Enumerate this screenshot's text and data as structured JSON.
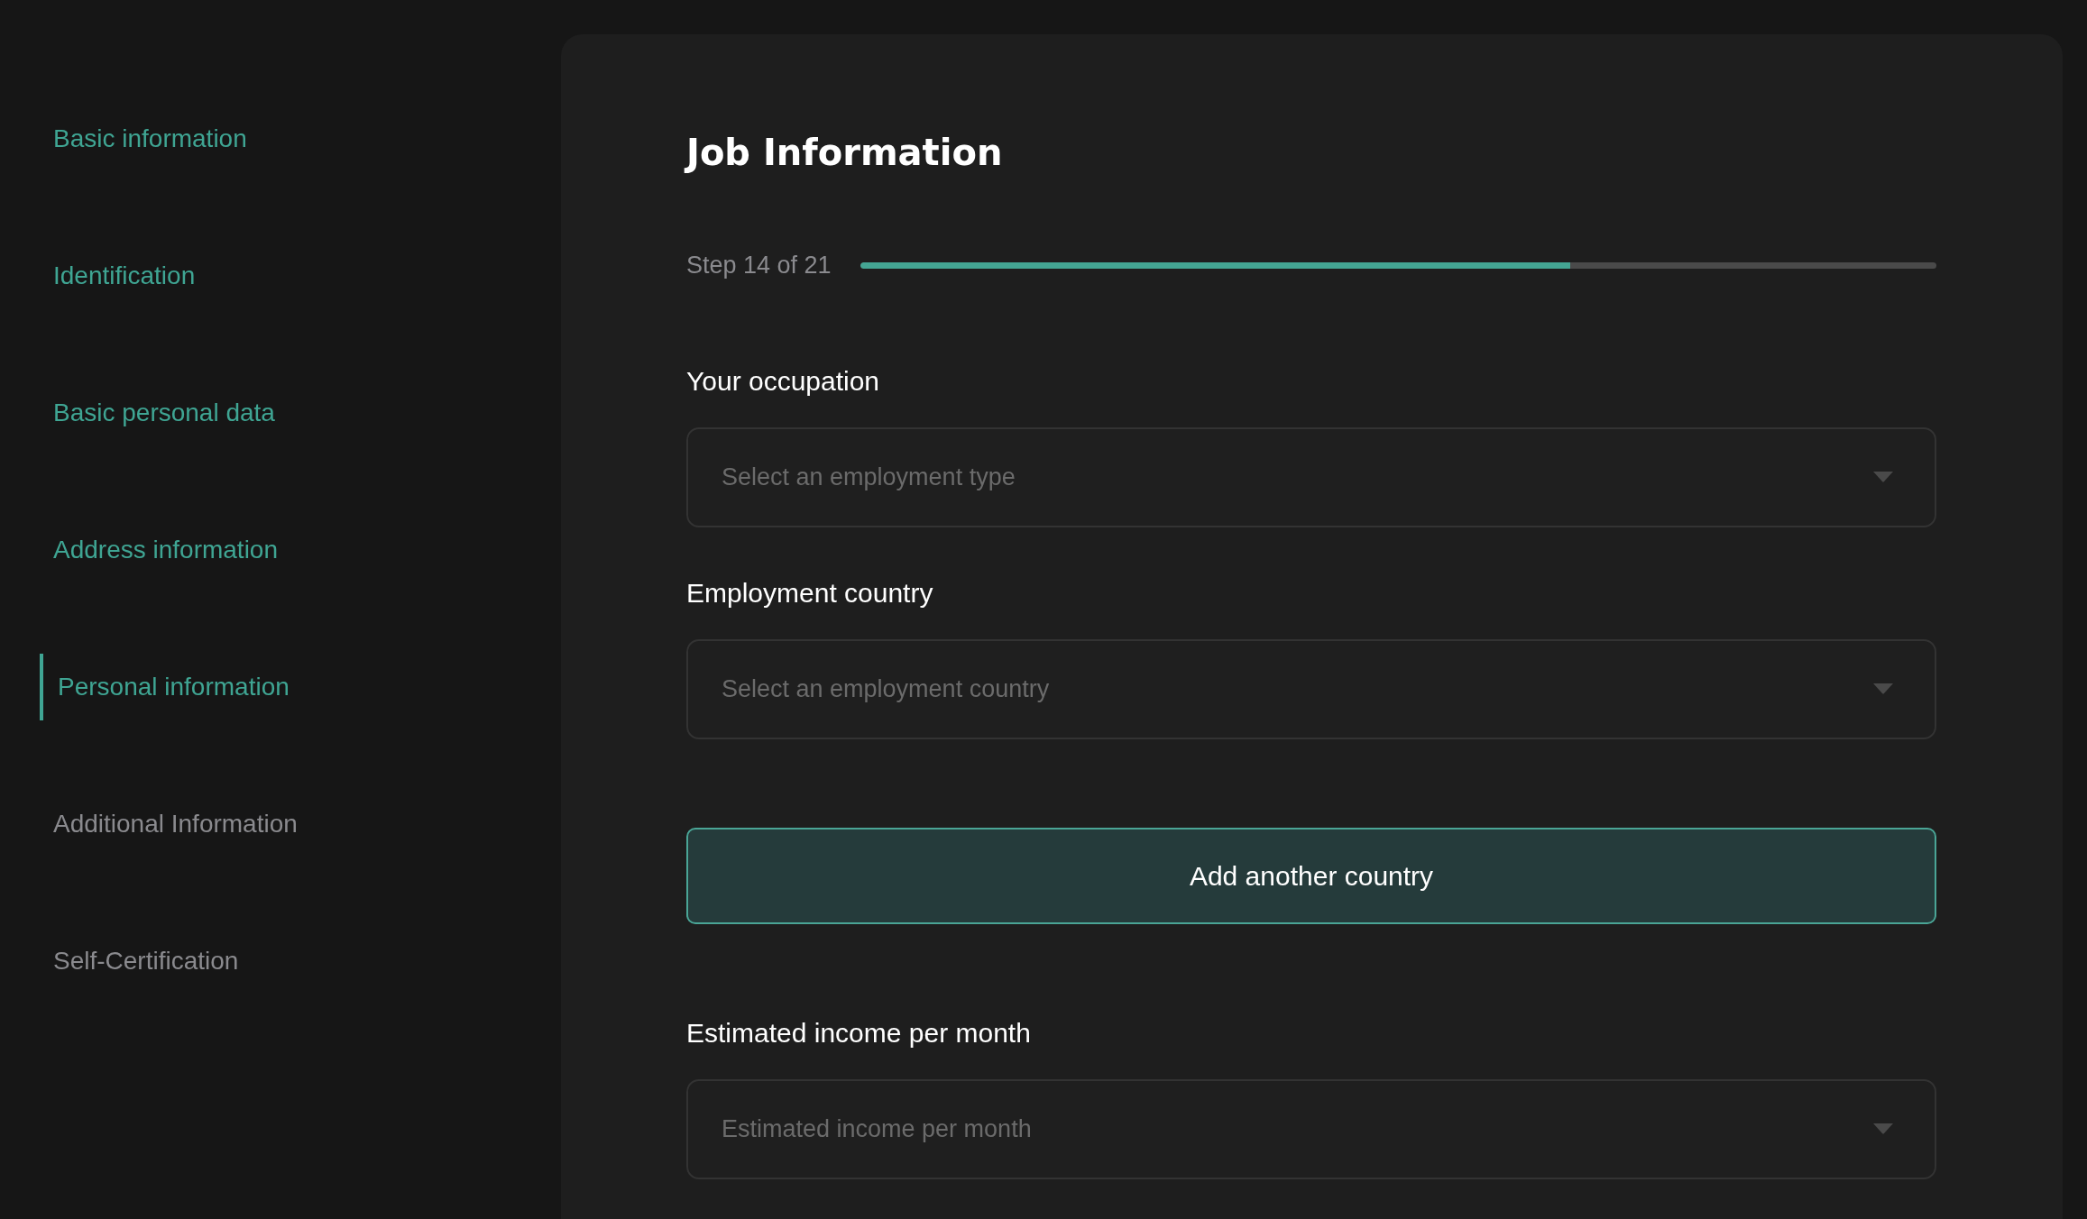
{
  "sidebar": {
    "items": [
      {
        "label": "Basic information",
        "completed": true,
        "selected": false
      },
      {
        "label": "Identification",
        "completed": true,
        "selected": false
      },
      {
        "label": "Basic personal data",
        "completed": true,
        "selected": false
      },
      {
        "label": "Address information",
        "completed": true,
        "selected": false
      },
      {
        "label": "Personal information",
        "completed": true,
        "selected": true
      },
      {
        "label": "Additional Information",
        "completed": false,
        "selected": false
      },
      {
        "label": "Self-Certification",
        "completed": false,
        "selected": false
      }
    ]
  },
  "form": {
    "title": "Job Information",
    "progress": {
      "label": "Step 14 of 21",
      "level": 0.66
    },
    "fields": [
      {
        "kind": "select",
        "label": "Your occupation",
        "placeholder": "Select an employment type"
      },
      {
        "kind": "select",
        "label": "Employment country",
        "placeholder": "Select an employment country"
      },
      {
        "kind": "button",
        "label": "Add another country"
      },
      {
        "kind": "select",
        "label": "Estimated income per month",
        "placeholder": "Estimated income per month"
      }
    ]
  }
}
